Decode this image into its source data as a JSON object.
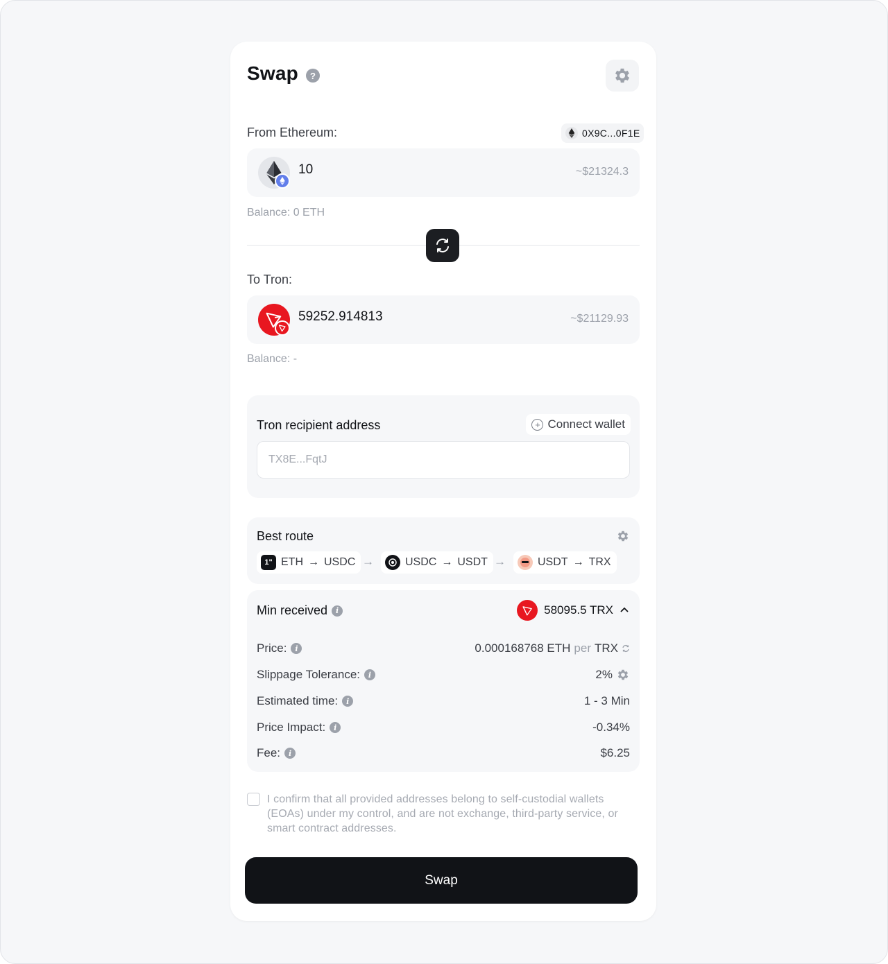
{
  "header": {
    "title": "Swap",
    "help_glyph": "?"
  },
  "from": {
    "label": "From Ethereum:",
    "wallet_address": "0X9C...0F1E",
    "amount": "10",
    "usd_value": "~$21324.3",
    "balance": "Balance: 0 ETH",
    "token_icon": "ethereum-icon"
  },
  "to": {
    "label": "To Tron:",
    "amount": "59252.914813",
    "usd_value": "~$21129.93",
    "balance": "Balance: -",
    "token_icon": "tron-icon"
  },
  "recipient": {
    "label": "Tron recipient address",
    "connect_label": "Connect wallet",
    "placeholder": "TX8E...FqtJ"
  },
  "route": {
    "title": "Best route",
    "hops": [
      {
        "icon_text": "1\"",
        "from": "ETH",
        "to": "USDC",
        "arrow": "→"
      },
      {
        "icon_text": "",
        "from": "USDC",
        "to": "USDT",
        "arrow": "→"
      },
      {
        "icon_text": "",
        "from": "USDT",
        "to": "TRX",
        "arrow": "→"
      }
    ],
    "between_arrow": "→"
  },
  "details": {
    "min_received_label": "Min received",
    "min_received_value": "58095.5 TRX",
    "info_glyph": "i",
    "price_label": "Price:",
    "price_amount": "0.000168768 ETH",
    "price_per": "per",
    "price_unit": "TRX",
    "slippage_label": "Slippage Tolerance:",
    "slippage_value": "2%",
    "time_label": "Estimated time:",
    "time_value": "1 - 3 Min",
    "impact_label": "Price Impact:",
    "impact_value": "-0.34%",
    "fee_label": "Fee:",
    "fee_value": "$6.25"
  },
  "confirm_text": "I confirm that all provided addresses belong to self-custodial wallets (EOAs) under my control, and are not exchange, third-party service, or smart contract addresses.",
  "swap_button": "Swap",
  "colors": {
    "accent_dark": "#111317",
    "tron_red": "#e81720",
    "eth_blue": "#627eea",
    "muted": "#9ca1aa",
    "panel": "#f6f7f9"
  }
}
